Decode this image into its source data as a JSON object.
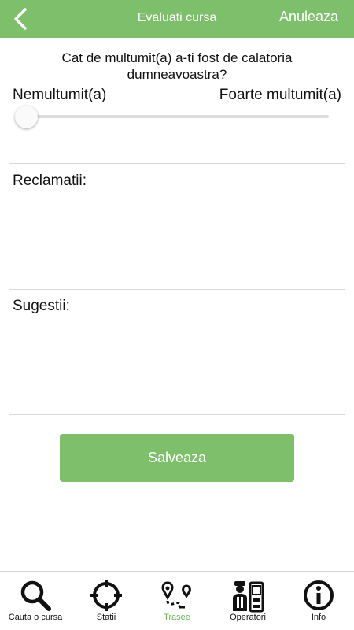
{
  "header": {
    "title": "Evaluati cursa",
    "cancel_label": "Anuleaza",
    "back_icon": "chevron-left-icon"
  },
  "rating": {
    "question": "Cat de multumit(a) a-ti fost de calatoria dumneavoastra?",
    "min_label": "Nemultumit(a)",
    "max_label": "Foarte multumit(a)",
    "value": 0
  },
  "complaints": {
    "label": "Reclamatii:",
    "value": ""
  },
  "suggestions": {
    "label": "Sugestii:",
    "value": ""
  },
  "save_label": "Salveaza",
  "colors": {
    "accent": "#7dbf6b",
    "active_tab": "#6bb35a"
  },
  "nav": {
    "items": [
      {
        "label": "Cauta o cursa",
        "icon": "search-icon",
        "active": false
      },
      {
        "label": "Statii",
        "icon": "crosshair-icon",
        "active": false
      },
      {
        "label": "Trasee",
        "icon": "route-icon",
        "active": true
      },
      {
        "label": "Operatori",
        "icon": "operator-icon",
        "active": false
      },
      {
        "label": "Info",
        "icon": "info-icon",
        "active": false
      }
    ]
  }
}
